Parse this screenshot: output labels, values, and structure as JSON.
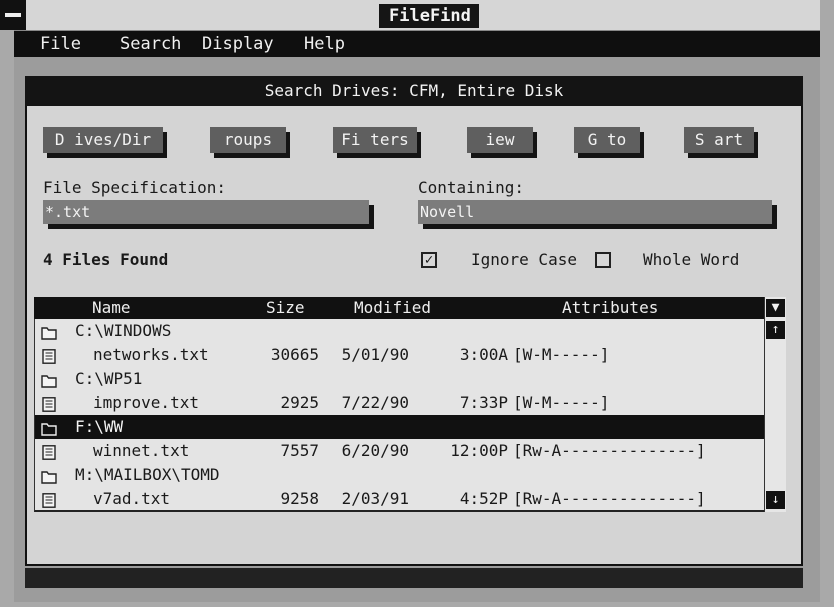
{
  "window": {
    "title": "FileFind"
  },
  "menu": {
    "file": "File",
    "search": "Search",
    "display": "Display",
    "help": "Help"
  },
  "dialog": {
    "title": "Search Drives: CFM, Entire Disk",
    "buttons": {
      "drives": "D ives/Dir",
      "groups": "roups",
      "filters": "Fi ters",
      "view": "iew",
      "goto": "G  to",
      "start": "S art"
    },
    "file_spec": {
      "label": "File Specification:",
      "value": "*.txt"
    },
    "containing": {
      "label": "Containing:",
      "value": "Novell"
    },
    "files_found": "4 Files Found",
    "ignore_case": {
      "label": "Ignore Case",
      "checked": true,
      "mark": "✓"
    },
    "whole_word": {
      "label": "Whole Word",
      "checked": false
    }
  },
  "results": {
    "columns": {
      "name": "Name",
      "size": "Size",
      "modified": "Modified",
      "attributes": "Attributes"
    },
    "rows": [
      {
        "type": "folder",
        "name": "C:\\WINDOWS",
        "size": "",
        "date": "",
        "time": "",
        "attr": "",
        "selected": false
      },
      {
        "type": "file",
        "name": "networks.txt",
        "size": "30665",
        "date": "5/01/90",
        "time": "3:00A",
        "attr": "[W-M-----]",
        "selected": false
      },
      {
        "type": "folder",
        "name": "C:\\WP51",
        "size": "",
        "date": "",
        "time": "",
        "attr": "",
        "selected": false
      },
      {
        "type": "file",
        "name": "improve.txt",
        "size": "2925",
        "date": "7/22/90",
        "time": "7:33P",
        "attr": "[W-M-----]",
        "selected": false
      },
      {
        "type": "folder",
        "name": "F:\\WW",
        "size": "",
        "date": "",
        "time": "",
        "attr": "",
        "selected": true
      },
      {
        "type": "file",
        "name": "winnet.txt",
        "size": "7557",
        "date": "6/20/90",
        "time": "12:00P",
        "attr": "[Rw-A--------------]",
        "selected": false
      },
      {
        "type": "folder",
        "name": "M:\\MAILBOX\\TOMD",
        "size": "",
        "date": "",
        "time": "",
        "attr": "",
        "selected": false
      },
      {
        "type": "file",
        "name": "v7ad.txt",
        "size": "9258",
        "date": "2/03/91",
        "time": "4:52P",
        "attr": "[Rw-A--------------]",
        "selected": false
      }
    ],
    "scroll": {
      "down_glyph": "▼",
      "up_glyph": "↑",
      "bottom_glyph": "↓"
    }
  },
  "icons": {
    "system_menu": "minus-icon",
    "folder": "folder-icon",
    "file": "document-icon"
  },
  "colors": {
    "titlebar": "#151515",
    "dialog_bg": "#d4d4d4",
    "button": "#5f5f5f",
    "field": "#7c7c7c",
    "selected_row": "#111111"
  }
}
